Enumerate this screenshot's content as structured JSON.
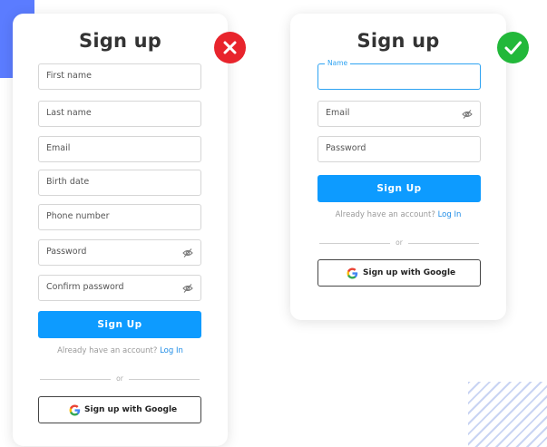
{
  "colors": {
    "primary": "#0d9bff",
    "link": "#1e8ce6",
    "error": "#e8242c",
    "success": "#22b83a",
    "accent": "#5b7cff"
  },
  "bad_form": {
    "title": "Sign up",
    "fields": {
      "first_name": "First name",
      "last_name": "Last name",
      "email": "Email",
      "birth_date": "Birth date",
      "phone": "Phone number",
      "password": "Password",
      "confirm_password": "Confirm password"
    },
    "submit_label": "Sign Up",
    "already_text": "Already have an account?",
    "login_link": "Log In",
    "or_text": "or",
    "google_label": "Sign up with Google",
    "badge_icon": "x-icon"
  },
  "good_form": {
    "title": "Sign up",
    "name_label": "Name",
    "fields": {
      "email": "Email",
      "password": "Password"
    },
    "submit_label": "Sign Up",
    "already_text": "Already have an account?",
    "login_link": "Log In",
    "or_text": "or",
    "google_label": "Sign up with Google",
    "badge_icon": "check-icon"
  }
}
